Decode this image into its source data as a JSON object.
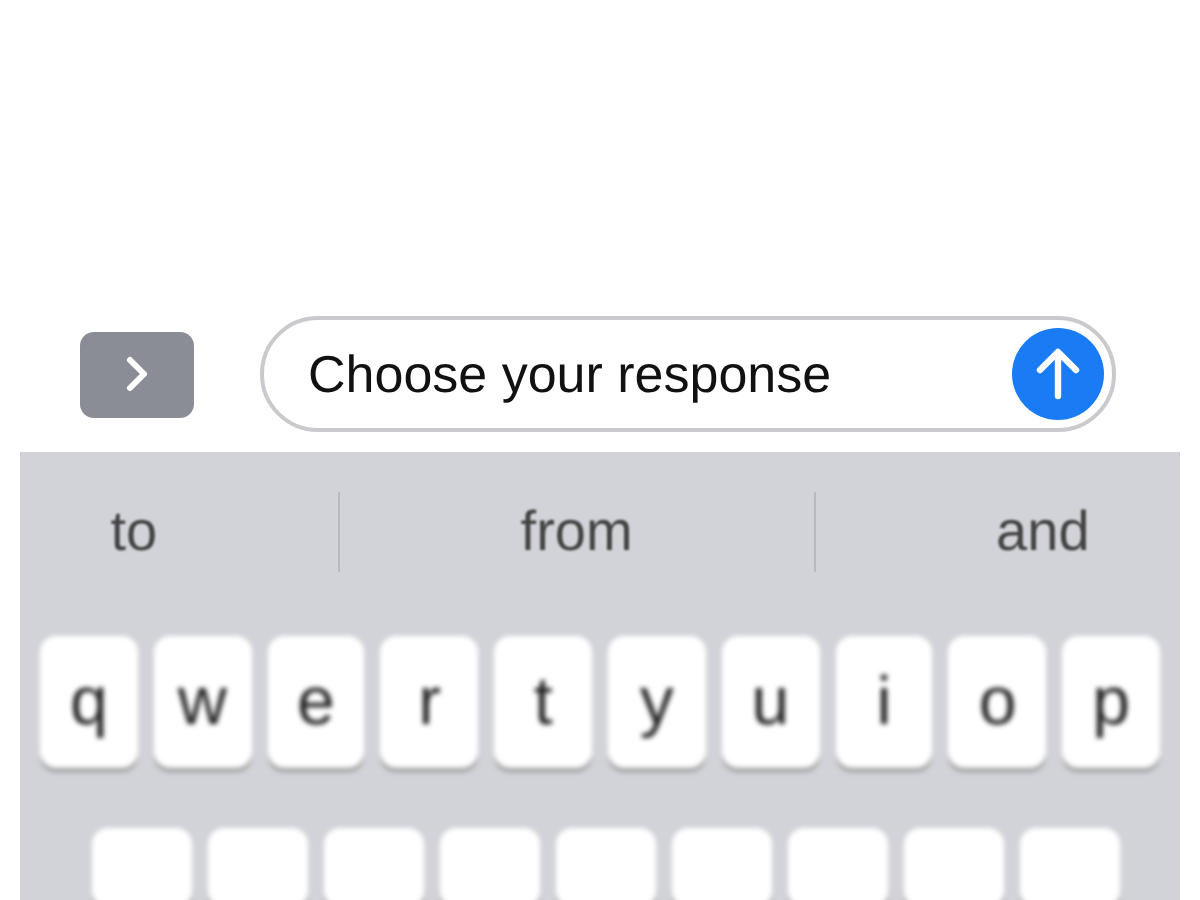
{
  "compose": {
    "placeholder": "Choose your response"
  },
  "suggestions": [
    "to",
    "from",
    "and"
  ],
  "keyboard": {
    "rows": [
      [
        "q",
        "w",
        "e",
        "r",
        "t",
        "y",
        "u",
        "i",
        "o",
        "p"
      ]
    ]
  }
}
